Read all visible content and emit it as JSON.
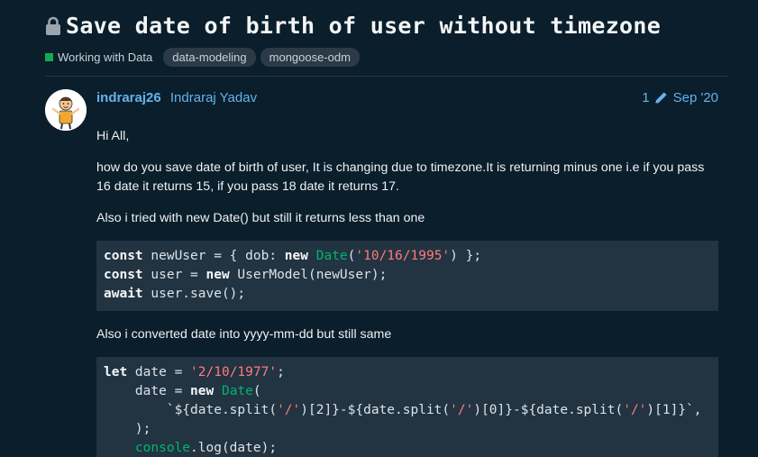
{
  "topic": {
    "title": "Save date of birth of user without timezone",
    "category": "Working with Data",
    "category_color": "#13aa52",
    "tags": [
      "data-modeling",
      "mongoose-odm"
    ]
  },
  "post": {
    "username": "indraraj26",
    "full_name": "Indraraj Yadav",
    "edit_count": "1",
    "date": "Sep '20",
    "paragraphs": [
      "Hi All,",
      "how do you save date of birth of user, It is changing due to timezone.It is returning minus one i.e if you pass 16 date it returns 15, if you pass 18 date it returns 17.",
      "Also i tried with new Date() but still it returns less than one",
      "Also i converted date into yyyy-mm-dd but still same"
    ],
    "code_block_1": [
      [
        {
          "t": "const",
          "c": "kw"
        },
        {
          "t": " newUser = { dob: ",
          "c": "plain"
        },
        {
          "t": "new",
          "c": "kw"
        },
        {
          "t": " ",
          "c": "plain"
        },
        {
          "t": "Date",
          "c": "cls"
        },
        {
          "t": "(",
          "c": "plain"
        },
        {
          "t": "'10/16/1995'",
          "c": "str"
        },
        {
          "t": ") };",
          "c": "plain"
        }
      ],
      [
        {
          "t": "const",
          "c": "kw"
        },
        {
          "t": " user = ",
          "c": "plain"
        },
        {
          "t": "new",
          "c": "kw"
        },
        {
          "t": " UserModel(newUser);",
          "c": "plain"
        }
      ],
      [
        {
          "t": "await",
          "c": "kw"
        },
        {
          "t": " user.save();",
          "c": "plain"
        }
      ]
    ],
    "code_block_2": [
      [
        {
          "t": "let",
          "c": "kw"
        },
        {
          "t": " date = ",
          "c": "plain"
        },
        {
          "t": "'2/10/1977'",
          "c": "str"
        },
        {
          "t": ";",
          "c": "plain"
        }
      ],
      [
        {
          "t": "    date = ",
          "c": "plain"
        },
        {
          "t": "new",
          "c": "kw"
        },
        {
          "t": " ",
          "c": "plain"
        },
        {
          "t": "Date",
          "c": "cls"
        },
        {
          "t": "(",
          "c": "plain"
        }
      ],
      [
        {
          "t": "        `${date.split(",
          "c": "plain"
        },
        {
          "t": "'/'",
          "c": "str"
        },
        {
          "t": ")[2]}-${date.split(",
          "c": "plain"
        },
        {
          "t": "'/'",
          "c": "str"
        },
        {
          "t": ")[0]}-${date.split(",
          "c": "plain"
        },
        {
          "t": "'/'",
          "c": "str"
        },
        {
          "t": ")[1]}`,",
          "c": "plain"
        }
      ],
      [
        {
          "t": "    );",
          "c": "plain"
        }
      ],
      [
        {
          "t": "    ",
          "c": "plain"
        },
        {
          "t": "console",
          "c": "cls"
        },
        {
          "t": ".log(date);",
          "c": "plain"
        }
      ]
    ]
  },
  "icons": {
    "lock": "lock-icon",
    "pencil": "pencil-icon",
    "avatar": "avatar-illustration"
  },
  "colors": {
    "background": "#0b1e2b",
    "link": "#63b3ed",
    "code_background": "#223341",
    "tag_background": "#2a3a46"
  }
}
